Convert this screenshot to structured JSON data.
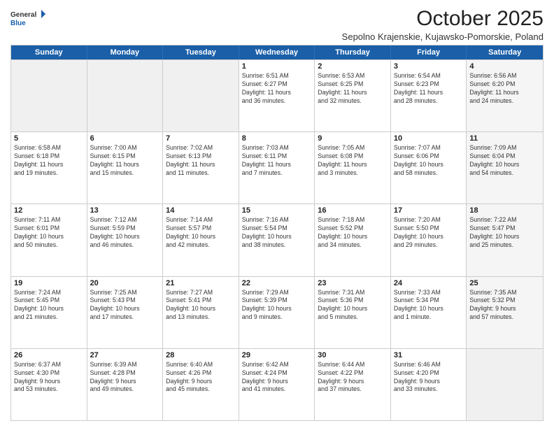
{
  "logo": {
    "general": "General",
    "blue": "Blue"
  },
  "header": {
    "month": "October 2025",
    "location": "Sepolno Krajenskie, Kujawsko-Pomorskie, Poland"
  },
  "days": [
    "Sunday",
    "Monday",
    "Tuesday",
    "Wednesday",
    "Thursday",
    "Friday",
    "Saturday"
  ],
  "weeks": [
    [
      {
        "day": "",
        "content": ""
      },
      {
        "day": "",
        "content": ""
      },
      {
        "day": "",
        "content": ""
      },
      {
        "day": "1",
        "content": "Sunrise: 6:51 AM\nSunset: 6:27 PM\nDaylight: 11 hours\nand 36 minutes."
      },
      {
        "day": "2",
        "content": "Sunrise: 6:53 AM\nSunset: 6:25 PM\nDaylight: 11 hours\nand 32 minutes."
      },
      {
        "day": "3",
        "content": "Sunrise: 6:54 AM\nSunset: 6:23 PM\nDaylight: 11 hours\nand 28 minutes."
      },
      {
        "day": "4",
        "content": "Sunrise: 6:56 AM\nSunset: 6:20 PM\nDaylight: 11 hours\nand 24 minutes."
      }
    ],
    [
      {
        "day": "5",
        "content": "Sunrise: 6:58 AM\nSunset: 6:18 PM\nDaylight: 11 hours\nand 19 minutes."
      },
      {
        "day": "6",
        "content": "Sunrise: 7:00 AM\nSunset: 6:15 PM\nDaylight: 11 hours\nand 15 minutes."
      },
      {
        "day": "7",
        "content": "Sunrise: 7:02 AM\nSunset: 6:13 PM\nDaylight: 11 hours\nand 11 minutes."
      },
      {
        "day": "8",
        "content": "Sunrise: 7:03 AM\nSunset: 6:11 PM\nDaylight: 11 hours\nand 7 minutes."
      },
      {
        "day": "9",
        "content": "Sunrise: 7:05 AM\nSunset: 6:08 PM\nDaylight: 11 hours\nand 3 minutes."
      },
      {
        "day": "10",
        "content": "Sunrise: 7:07 AM\nSunset: 6:06 PM\nDaylight: 10 hours\nand 58 minutes."
      },
      {
        "day": "11",
        "content": "Sunrise: 7:09 AM\nSunset: 6:04 PM\nDaylight: 10 hours\nand 54 minutes."
      }
    ],
    [
      {
        "day": "12",
        "content": "Sunrise: 7:11 AM\nSunset: 6:01 PM\nDaylight: 10 hours\nand 50 minutes."
      },
      {
        "day": "13",
        "content": "Sunrise: 7:12 AM\nSunset: 5:59 PM\nDaylight: 10 hours\nand 46 minutes."
      },
      {
        "day": "14",
        "content": "Sunrise: 7:14 AM\nSunset: 5:57 PM\nDaylight: 10 hours\nand 42 minutes."
      },
      {
        "day": "15",
        "content": "Sunrise: 7:16 AM\nSunset: 5:54 PM\nDaylight: 10 hours\nand 38 minutes."
      },
      {
        "day": "16",
        "content": "Sunrise: 7:18 AM\nSunset: 5:52 PM\nDaylight: 10 hours\nand 34 minutes."
      },
      {
        "day": "17",
        "content": "Sunrise: 7:20 AM\nSunset: 5:50 PM\nDaylight: 10 hours\nand 29 minutes."
      },
      {
        "day": "18",
        "content": "Sunrise: 7:22 AM\nSunset: 5:47 PM\nDaylight: 10 hours\nand 25 minutes."
      }
    ],
    [
      {
        "day": "19",
        "content": "Sunrise: 7:24 AM\nSunset: 5:45 PM\nDaylight: 10 hours\nand 21 minutes."
      },
      {
        "day": "20",
        "content": "Sunrise: 7:25 AM\nSunset: 5:43 PM\nDaylight: 10 hours\nand 17 minutes."
      },
      {
        "day": "21",
        "content": "Sunrise: 7:27 AM\nSunset: 5:41 PM\nDaylight: 10 hours\nand 13 minutes."
      },
      {
        "day": "22",
        "content": "Sunrise: 7:29 AM\nSunset: 5:39 PM\nDaylight: 10 hours\nand 9 minutes."
      },
      {
        "day": "23",
        "content": "Sunrise: 7:31 AM\nSunset: 5:36 PM\nDaylight: 10 hours\nand 5 minutes."
      },
      {
        "day": "24",
        "content": "Sunrise: 7:33 AM\nSunset: 5:34 PM\nDaylight: 10 hours\nand 1 minute."
      },
      {
        "day": "25",
        "content": "Sunrise: 7:35 AM\nSunset: 5:32 PM\nDaylight: 9 hours\nand 57 minutes."
      }
    ],
    [
      {
        "day": "26",
        "content": "Sunrise: 6:37 AM\nSunset: 4:30 PM\nDaylight: 9 hours\nand 53 minutes."
      },
      {
        "day": "27",
        "content": "Sunrise: 6:39 AM\nSunset: 4:28 PM\nDaylight: 9 hours\nand 49 minutes."
      },
      {
        "day": "28",
        "content": "Sunrise: 6:40 AM\nSunset: 4:26 PM\nDaylight: 9 hours\nand 45 minutes."
      },
      {
        "day": "29",
        "content": "Sunrise: 6:42 AM\nSunset: 4:24 PM\nDaylight: 9 hours\nand 41 minutes."
      },
      {
        "day": "30",
        "content": "Sunrise: 6:44 AM\nSunset: 4:22 PM\nDaylight: 9 hours\nand 37 minutes."
      },
      {
        "day": "31",
        "content": "Sunrise: 6:46 AM\nSunset: 4:20 PM\nDaylight: 9 hours\nand 33 minutes."
      },
      {
        "day": "",
        "content": ""
      }
    ]
  ]
}
